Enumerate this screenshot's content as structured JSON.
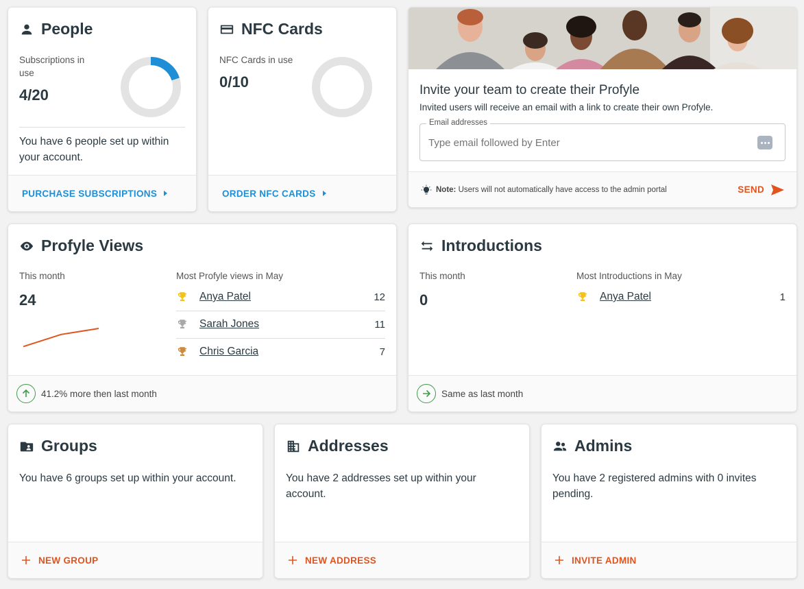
{
  "people": {
    "title": "People",
    "sub_label": "Subscriptions in use",
    "value": "4/20",
    "fraction_used": 0.2,
    "description": "You have 6 people set up within your account.",
    "action": "PURCHASE SUBSCRIPTIONS"
  },
  "nfc": {
    "title": "NFC Cards",
    "sub_label": "NFC Cards in use",
    "value": "0/10",
    "fraction_used": 0,
    "action": "ORDER NFC CARDS"
  },
  "invite": {
    "title": "Invite your team to create their Profyle",
    "subtitle": "Invited users will receive an email with a link to create their own Profyle.",
    "field_label": "Email addresses",
    "placeholder": "Type email followed by Enter",
    "note_bold": "Note:",
    "note_text": "Users will not automatically have access to the admin portal",
    "send_label": "SEND"
  },
  "views": {
    "title": "Profyle Views",
    "period_label": "This month",
    "value": "24",
    "ranking_label": "Most Profyle views in May",
    "ranking": [
      {
        "name": "Anya Patel",
        "count": "12",
        "trophy": "gold"
      },
      {
        "name": "Sarah Jones",
        "count": "11",
        "trophy": "silver"
      },
      {
        "name": "Chris Garcia",
        "count": "7",
        "trophy": "bronze"
      }
    ],
    "trend_text": "41.2% more then last month",
    "sparkline": [
      14,
      18,
      20
    ]
  },
  "intros": {
    "title": "Introductions",
    "period_label": "This month",
    "value": "0",
    "ranking_label": "Most Introductions in May",
    "ranking": [
      {
        "name": "Anya Patel",
        "count": "1",
        "trophy": "gold"
      }
    ],
    "trend_text": "Same as last month"
  },
  "groups": {
    "title": "Groups",
    "description": "You have 6 groups set up within your account.",
    "action": "NEW GROUP"
  },
  "addresses": {
    "title": "Addresses",
    "description": "You have 2 addresses set up within your account.",
    "action": "NEW ADDRESS"
  },
  "admins": {
    "title": "Admins",
    "description": "You have 2 registered admins with 0 invites pending.",
    "action": "INVITE ADMIN"
  },
  "colors": {
    "accent_blue": "#1e8fd6",
    "accent_orange": "#e0541e",
    "gold": "#f2c21b",
    "silver": "#a8a8a8",
    "bronze": "#cc8a3c",
    "green": "#3f9a4a"
  }
}
